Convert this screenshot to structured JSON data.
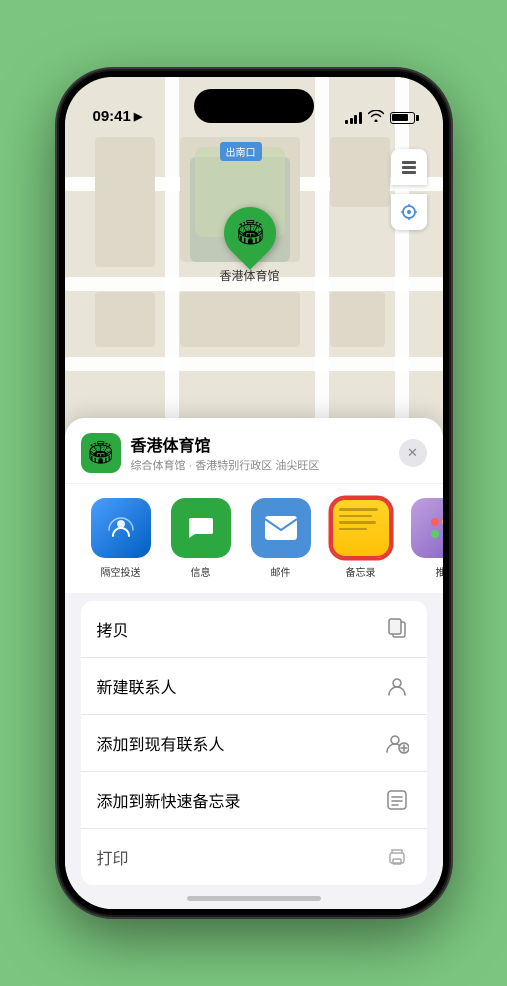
{
  "status_bar": {
    "time": "09:41",
    "location_arrow": "▶"
  },
  "map": {
    "label": "南口",
    "label_prefix": "出"
  },
  "marker": {
    "label": "香港体育馆",
    "icon": "🏟"
  },
  "map_controls": {
    "layers_icon": "🗺",
    "location_icon": "◎"
  },
  "venue": {
    "name": "香港体育馆",
    "description": "综合体育馆 · 香港特别行政区 油尖旺区",
    "icon": "🏟"
  },
  "share_items": [
    {
      "id": "airdrop",
      "label": "隔空投送",
      "icon_type": "airdrop"
    },
    {
      "id": "message",
      "label": "信息",
      "icon_type": "message"
    },
    {
      "id": "mail",
      "label": "邮件",
      "icon_type": "mail"
    },
    {
      "id": "notes",
      "label": "备忘录",
      "icon_type": "notes"
    },
    {
      "id": "more",
      "label": "推",
      "icon_type": "more"
    }
  ],
  "actions": [
    {
      "id": "copy",
      "label": "拷贝",
      "icon": "⧉"
    },
    {
      "id": "new-contact",
      "label": "新建联系人",
      "icon": "👤"
    },
    {
      "id": "add-contact",
      "label": "添加到现有联系人",
      "icon": "👥"
    },
    {
      "id": "quick-note",
      "label": "添加到新快速备忘录",
      "icon": "⊞"
    },
    {
      "id": "print",
      "label": "打印",
      "icon": "🖨"
    }
  ],
  "close_icon": "✕"
}
